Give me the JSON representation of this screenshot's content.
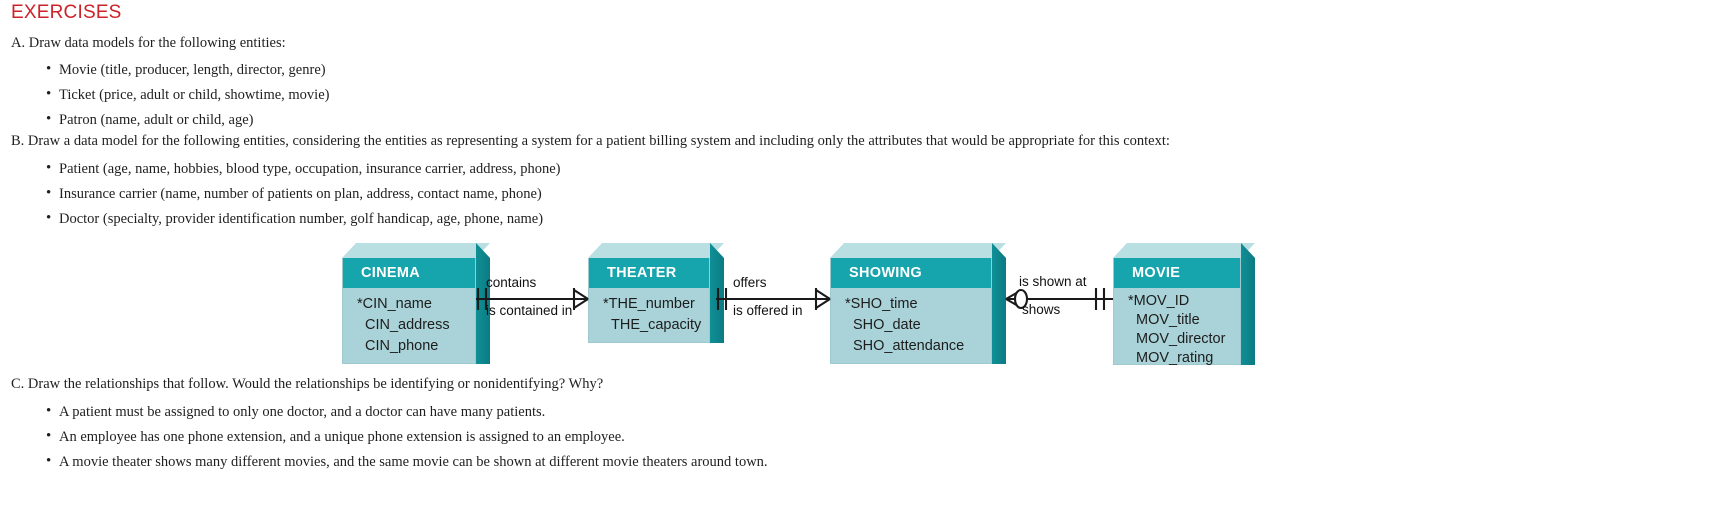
{
  "page": {
    "title": "EXERCISES",
    "title_color": "#cc2229",
    "background": "#ffffff"
  },
  "sections": [
    {
      "id": "A",
      "prompt": "A. Draw data models for the following entities:",
      "items": [
        "Movie (title, producer, length, director, genre)",
        "Ticket (price, adult or child, showtime, movie)",
        "Patron (name, adult or child, age)"
      ]
    },
    {
      "id": "B",
      "prompt": "B. Draw a data model for the following entities, considering the entities as representing a system for a patient billing system and including only the attributes that would be appropriate for this context:",
      "items": [
        "Patient (age, name, hobbies, blood type, occupation, insurance carrier, address, phone)",
        "Insurance carrier (name, number of patients on plan, address, contact name, phone)",
        "Doctor (specialty, provider identification number, golf handicap, age, phone, name)"
      ]
    },
    {
      "id": "C",
      "prompt": "C. Draw the relationships that follow. Would the relationships be identifying or nonidentifying? Why?",
      "items": [
        "A patient must be assigned to only one doctor, and a doctor can have many patients.",
        "An employee has one phone extension, and a unique phone extension is assigned to an employee.",
        "A movie theater shows many different movies, and the same movie can be shown at different movie theaters around town."
      ]
    }
  ],
  "diagram": {
    "colors": {
      "header_teal": "#17a5ad",
      "body_teal": "#a9d3d8",
      "top_face": "#b9dfe2",
      "side_face": "#0f8f96",
      "line": "#1a1a1a"
    },
    "entities": [
      {
        "name": "CINEMA",
        "attributes": [
          "*CIN_name",
          "CIN_address",
          "CIN_phone"
        ]
      },
      {
        "name": "THEATER",
        "attributes": [
          "*THE_number",
          "THE_capacity"
        ]
      },
      {
        "name": "SHOWING",
        "attributes": [
          "*SHO_time",
          "SHO_date",
          "SHO_attendance"
        ]
      },
      {
        "name": "MOVIE",
        "attributes": [
          "*MOV_ID",
          "MOV_title",
          "MOV_director",
          "MOV_rating"
        ]
      }
    ],
    "relationships": [
      {
        "from": "CINEMA",
        "to": "THEATER",
        "label_top": "contains",
        "label_bottom": "is contained in",
        "from_notation": "one-mandatory",
        "to_notation": "many-mandatory"
      },
      {
        "from": "THEATER",
        "to": "SHOWING",
        "label_top": "offers",
        "label_bottom": "is offered in",
        "from_notation": "one-mandatory",
        "to_notation": "many-mandatory"
      },
      {
        "from": "SHOWING",
        "to": "MOVIE",
        "label_top": "is shown at",
        "label_bottom": "shows",
        "from_notation": "many-optional",
        "to_notation": "one-mandatory"
      }
    ]
  }
}
